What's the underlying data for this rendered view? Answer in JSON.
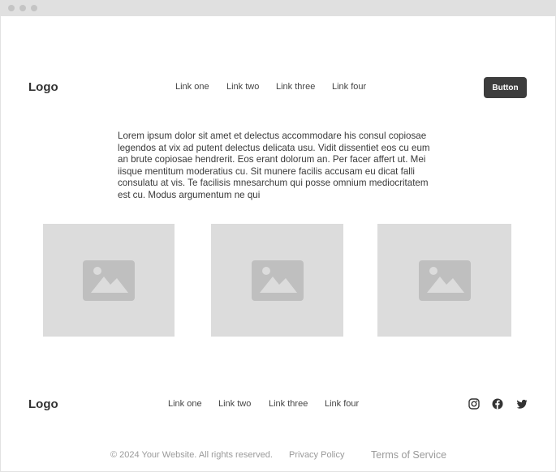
{
  "window": {
    "controls": [
      "close",
      "minimize",
      "maximize"
    ]
  },
  "header": {
    "logo": "Logo",
    "links": [
      "Link one",
      "Link two",
      "Link three",
      "Link four"
    ],
    "button": "Button"
  },
  "hero": {
    "text": "Lorem ipsum dolor sit amet et delectus accommodare his consul copiosae legendos at vix ad putent delectus delicata usu. Vidit dissentiet eos cu eum an brute copiosae hendrerit. Eos erant dolorum an. Per facer affert ut. Mei iisque mentitum moderatius cu. Sit munere facilis accusam eu dicat falli consulatu at vis. Te facilisis mnesarchum qui posse omnium mediocritatem est cu. Modus argumentum ne qui"
  },
  "gallery": {
    "images": [
      "image-placeholder-icon",
      "image-placeholder-icon",
      "image-placeholder-icon"
    ]
  },
  "footer": {
    "logo": "Logo",
    "links": [
      "Link one",
      "Link two",
      "Link three",
      "Link four"
    ],
    "social": [
      "instagram-icon",
      "facebook-icon",
      "twitter-icon"
    ],
    "copyright": "© 2024 Your Website. All rights reserved.",
    "privacy": "Privacy Policy",
    "terms": "Terms of Service"
  },
  "colors": {
    "button_bg": "#3d3d3d",
    "placeholder_bg": "#dcdcdc",
    "placeholder_icon": "#bfbfbf"
  }
}
